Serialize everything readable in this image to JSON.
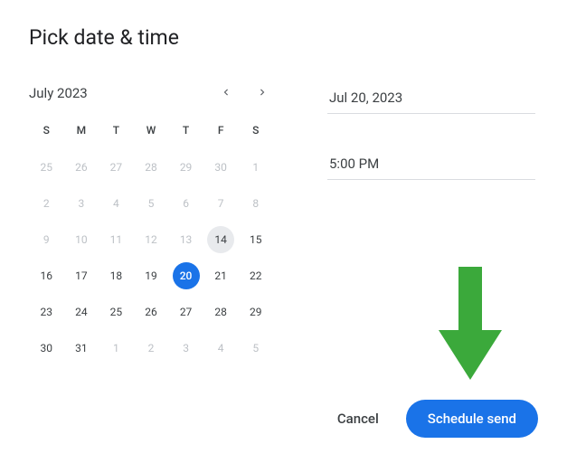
{
  "title": "Pick date & time",
  "calendar": {
    "month_label": "July 2023",
    "dow": [
      "S",
      "M",
      "T",
      "W",
      "T",
      "F",
      "S"
    ],
    "weeks": [
      [
        {
          "d": 25,
          "outside": true
        },
        {
          "d": 26,
          "outside": true
        },
        {
          "d": 27,
          "outside": true
        },
        {
          "d": 28,
          "outside": true
        },
        {
          "d": 29,
          "outside": true
        },
        {
          "d": 30,
          "outside": true
        },
        {
          "d": 1,
          "outside": true
        }
      ],
      [
        {
          "d": 2,
          "outside": true
        },
        {
          "d": 3,
          "outside": true
        },
        {
          "d": 4,
          "outside": true
        },
        {
          "d": 5,
          "outside": true
        },
        {
          "d": 6,
          "outside": true
        },
        {
          "d": 7,
          "outside": true
        },
        {
          "d": 8,
          "outside": true
        }
      ],
      [
        {
          "d": 9,
          "outside": true
        },
        {
          "d": 10,
          "outside": true
        },
        {
          "d": 11,
          "outside": true
        },
        {
          "d": 12,
          "outside": true
        },
        {
          "d": 13,
          "outside": true
        },
        {
          "d": 14,
          "today": true
        },
        {
          "d": 15
        }
      ],
      [
        {
          "d": 16
        },
        {
          "d": 17
        },
        {
          "d": 18
        },
        {
          "d": 19
        },
        {
          "d": 20,
          "selected": true
        },
        {
          "d": 21
        },
        {
          "d": 22
        }
      ],
      [
        {
          "d": 23
        },
        {
          "d": 24
        },
        {
          "d": 25
        },
        {
          "d": 26
        },
        {
          "d": 27
        },
        {
          "d": 28
        },
        {
          "d": 29
        }
      ],
      [
        {
          "d": 30
        },
        {
          "d": 31
        },
        {
          "d": 1,
          "outside": true
        },
        {
          "d": 2,
          "outside": true
        },
        {
          "d": 3,
          "outside": true
        },
        {
          "d": 4,
          "outside": true
        },
        {
          "d": 5,
          "outside": true
        }
      ]
    ]
  },
  "fields": {
    "date_value": "Jul 20, 2023",
    "time_value": "5:00 PM"
  },
  "actions": {
    "cancel": "Cancel",
    "schedule": "Schedule send"
  },
  "annotation": {
    "arrow_color": "#3ba93b"
  }
}
